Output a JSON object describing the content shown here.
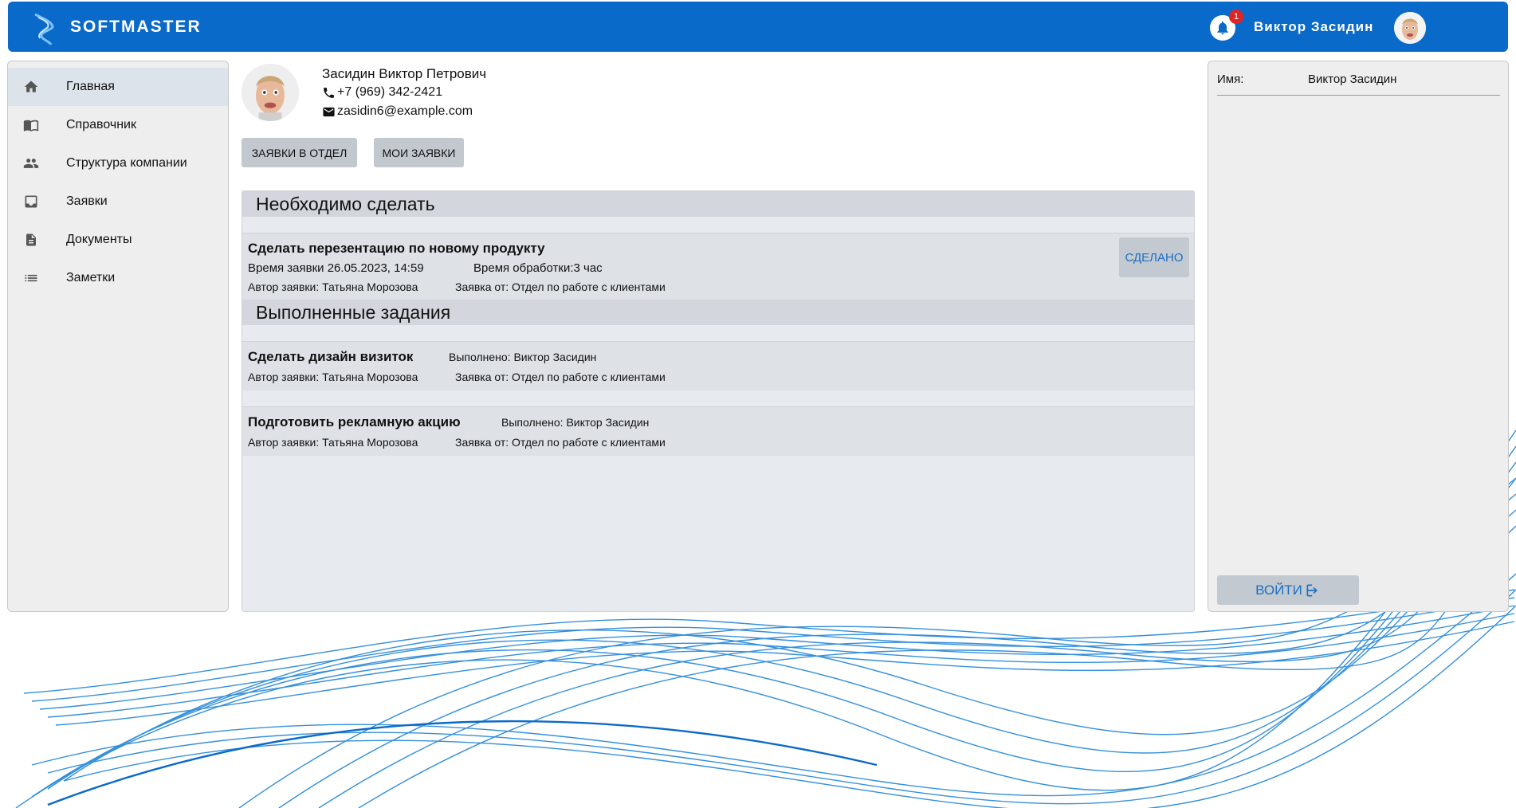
{
  "header": {
    "brand": "SOFTMASTER",
    "notification_count": "1",
    "user_name": "Виктор Засидин"
  },
  "sidebar": {
    "items": [
      {
        "label": "Главная",
        "icon": "home-icon",
        "active": true
      },
      {
        "label": "Справочник",
        "icon": "book-icon",
        "active": false
      },
      {
        "label": "Структура компании",
        "icon": "people-icon",
        "active": false
      },
      {
        "label": "Заявки",
        "icon": "inbox-icon",
        "active": false
      },
      {
        "label": "Документы",
        "icon": "document-icon",
        "active": false
      },
      {
        "label": "Заметки",
        "icon": "list-icon",
        "active": false
      }
    ]
  },
  "profile": {
    "full_name": "Засидин Виктор Петрович",
    "phone": "+7 (969) 342-2421",
    "email": "zasidin6@example.com"
  },
  "tabs": {
    "department": "ЗАЯВКИ В ОТДЕЛ",
    "mine": "МОИ ЗАЯВКИ"
  },
  "todo": {
    "heading": "Необходимо сделать",
    "tasks": [
      {
        "title": "Сделать перезентацию по новому продукту",
        "time": "Время заявки 26.05.2023, 14:59",
        "processing": "Время обработки:3 час",
        "author": "Автор заявки: Татьяна Морозова",
        "from": "Заявка от: Отдел по работе с клиентами",
        "done_label": "СДЕЛАНО"
      }
    ]
  },
  "completed": {
    "heading": "Выполненные задания",
    "tasks": [
      {
        "title": "Сделать дизайн визиток",
        "done_by": "Выполнено: Виктор Засидин",
        "author": "Автор заявки: Татьяна Морозова",
        "from": "Заявка от: Отдел по работе с клиентами"
      },
      {
        "title": "Подготовить рекламную акцию",
        "done_by": "Выполнено: Виктор Засидин",
        "author": "Автор заявки: Татьяна Морозова",
        "from": "Заявка от: Отдел по работе с клиентами"
      }
    ]
  },
  "right_panel": {
    "name_label": "Имя:",
    "name_value": "Виктор Засидин",
    "login_label": "ВОЙТИ"
  },
  "colors": {
    "brand_blue": "#0a6ac9",
    "accent_text": "#1b6fc2",
    "badge_red": "#e02424"
  }
}
